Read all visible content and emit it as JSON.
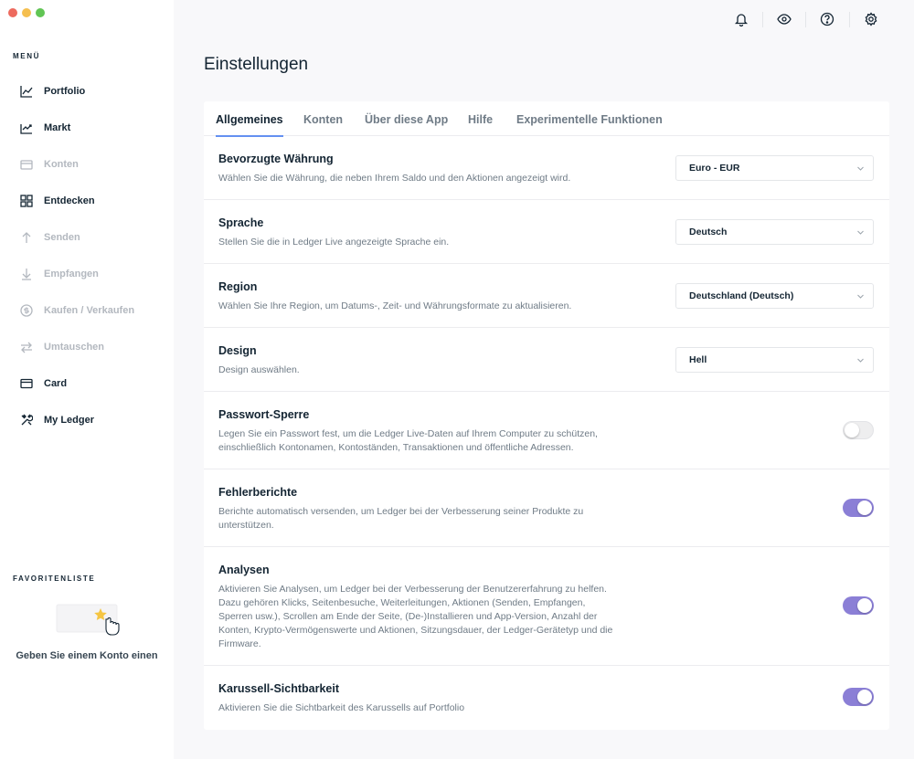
{
  "window": {
    "controls": [
      "close",
      "minimize",
      "maximize"
    ]
  },
  "sidebar": {
    "menu_title": "MENÜ",
    "items": [
      {
        "label": "Portfolio",
        "icon": "chart-line-icon",
        "disabled": false
      },
      {
        "label": "Markt",
        "icon": "market-chart-icon",
        "disabled": false
      },
      {
        "label": "Konten",
        "icon": "wallet-icon",
        "disabled": true
      },
      {
        "label": "Entdecken",
        "icon": "grid-icon",
        "disabled": false
      },
      {
        "label": "Senden",
        "icon": "arrow-up-icon",
        "disabled": true
      },
      {
        "label": "Empfangen",
        "icon": "arrow-down-icon",
        "disabled": true
      },
      {
        "label": "Kaufen / Verkaufen",
        "icon": "coin-icon",
        "disabled": true
      },
      {
        "label": "Umtauschen",
        "icon": "swap-icon",
        "disabled": true
      },
      {
        "label": "Card",
        "icon": "card-icon",
        "disabled": false
      },
      {
        "label": "My Ledger",
        "icon": "tools-icon",
        "disabled": false
      }
    ],
    "favorites_title": "FAVORITENLISTE",
    "favorites_empty_text": "Geben Sie einem Konto einen"
  },
  "topbar": {
    "icons": [
      "bell-icon",
      "eye-icon",
      "help-icon",
      "gear-icon"
    ]
  },
  "page": {
    "title": "Einstellungen"
  },
  "tabs": [
    {
      "label": "Allgemeines",
      "active": true
    },
    {
      "label": "Konten",
      "active": false
    },
    {
      "label": "Über diese App",
      "active": false
    },
    {
      "label": "Hilfe",
      "active": false
    },
    {
      "label": "Experimentelle Funktionen",
      "active": false
    }
  ],
  "settings": [
    {
      "title": "Bevorzugte Währung",
      "desc": "Wählen Sie die Währung, die neben Ihrem Saldo und den Aktionen angezeigt wird.",
      "control": "select",
      "value": "Euro - EUR"
    },
    {
      "title": "Sprache",
      "desc": "Stellen Sie die in Ledger Live angezeigte Sprache ein.",
      "control": "select",
      "value": "Deutsch"
    },
    {
      "title": "Region",
      "desc": "Wählen Sie Ihre Region, um Datums-, Zeit- und Währungsformate zu aktualisieren.",
      "control": "select",
      "value": "Deutschland (Deutsch)"
    },
    {
      "title": "Design",
      "desc": "Design auswählen.",
      "control": "select",
      "value": "Hell"
    },
    {
      "title": "Passwort-Sperre",
      "desc": "Legen Sie ein Passwort fest, um die Ledger Live-Daten auf Ihrem Computer zu schützen, einschließlich Kontonamen, Kontoständen, Transaktionen und öffentliche Adressen.",
      "control": "toggle",
      "on": false
    },
    {
      "title": "Fehlerberichte",
      "desc": "Berichte automatisch versenden, um Ledger bei der Verbesserung seiner Produkte zu unterstützen.",
      "control": "toggle",
      "on": true
    },
    {
      "title": "Analysen",
      "desc": "Aktivieren Sie Analysen, um Ledger bei der Verbesserung der Benutzererfahrung zu helfen. Dazu gehören Klicks, Seitenbesuche, Weiterleitungen, Aktionen (Senden, Empfangen, Sperren usw.), Scrollen am Ende der Seite, (De-)Installieren und App-Version, Anzahl der Konten, Krypto-Vermögenswerte und Aktionen, Sitzungsdauer, der Ledger-Gerätetyp und die Firmware.",
      "control": "toggle",
      "on": true
    },
    {
      "title": "Karussell-Sichtbarkeit",
      "desc": "Aktivieren Sie die Sichtbarkeit des Karussells auf Portfolio",
      "control": "toggle",
      "on": true
    }
  ],
  "colors": {
    "accent": "#8b7fd6",
    "tab_underline": "#6490f1",
    "text_primary": "#142533",
    "text_secondary": "#6f7b86",
    "background": "#f8f8fa"
  }
}
